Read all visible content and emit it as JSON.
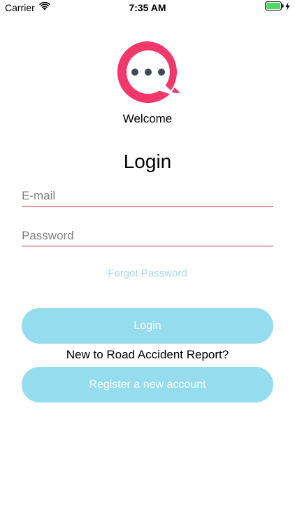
{
  "status_bar": {
    "carrier": "Carrier",
    "time": "7:35 AM",
    "wifi_icon": "wifi-icon",
    "battery_icon": "battery-charging-icon",
    "battery_color": "#4cd964"
  },
  "logo": {
    "icon": "chat-bubble-icon",
    "ring_color": "#f0386b",
    "dots_color": "#404a56"
  },
  "welcome_text": "Welcome",
  "login_title": "Login",
  "form": {
    "email_placeholder": "E-mail",
    "email_value": "",
    "password_placeholder": "Password",
    "password_value": "",
    "underline_color": "#c0392b"
  },
  "forgot_password": "Forgot Password",
  "login_button": "Login",
  "new_user_text": "New to Road Accident Report?",
  "register_button": "Register a new account",
  "colors": {
    "button_bg": "#96dcef",
    "button_text": "#ffffff",
    "link": "#a8d8ec"
  }
}
